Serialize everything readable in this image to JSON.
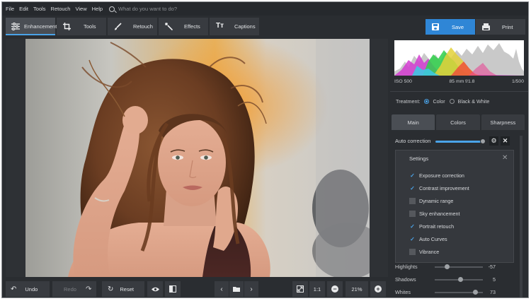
{
  "menu": [
    "File",
    "Edit",
    "Tools",
    "Retouch",
    "View",
    "Help"
  ],
  "search": {
    "placeholder": "What do you want to do?"
  },
  "tabs": [
    {
      "label": "Enhancement",
      "icon": "sliders-icon"
    },
    {
      "label": "Tools",
      "icon": "crop-icon"
    },
    {
      "label": "Retouch",
      "icon": "brush-icon"
    },
    {
      "label": "Effects",
      "icon": "magic-wand-icon"
    },
    {
      "label": "Captions",
      "icon": "text-icon"
    }
  ],
  "actions": {
    "save": "Save",
    "print": "Print"
  },
  "bottom": {
    "undo": "Undo",
    "redo": "Redo",
    "reset": "Reset",
    "ratio": "1:1",
    "zoom": "21%"
  },
  "histogram": {
    "iso": "ISO 500",
    "lens": "85 mm f/1.8",
    "shutter": "1/500"
  },
  "treatment": {
    "label": "Treatment:",
    "options": [
      "Color",
      "Black & White"
    ],
    "selected": "Color"
  },
  "panel_tabs": [
    "Main",
    "Colors",
    "Sharpness"
  ],
  "auto_correction": {
    "label": "Auto correction",
    "value": 1.0
  },
  "settings": {
    "title": "Settings",
    "items": [
      {
        "label": "Exposure correction",
        "checked": true
      },
      {
        "label": "Contrast improvement",
        "checked": true
      },
      {
        "label": "Dynamic range",
        "checked": false
      },
      {
        "label": "Sky enhancement",
        "checked": false
      },
      {
        "label": "Portrait retouch",
        "checked": true
      },
      {
        "label": "Auto Curves",
        "checked": true
      },
      {
        "label": "Vibrance",
        "checked": false
      }
    ]
  },
  "adjustments": [
    {
      "label": "Highlights",
      "value": "-57",
      "position": 0.22
    },
    {
      "label": "Shadows",
      "value": "5",
      "position": 0.52
    },
    {
      "label": "Whites",
      "value": "73",
      "position": 0.86
    }
  ],
  "colors": {
    "accent": "#2f86d6",
    "accent_light": "#4aa3e8",
    "background": "#2a2d31"
  }
}
